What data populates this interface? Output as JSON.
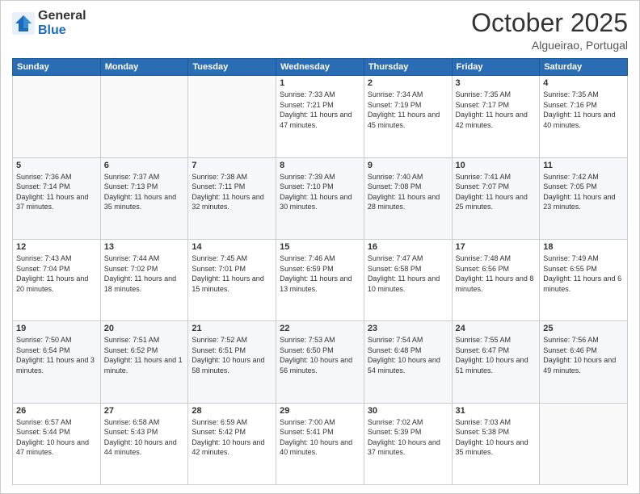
{
  "logo": {
    "general": "General",
    "blue": "Blue"
  },
  "header": {
    "month": "October 2025",
    "location": "Algueirao, Portugal"
  },
  "weekdays": [
    "Sunday",
    "Monday",
    "Tuesday",
    "Wednesday",
    "Thursday",
    "Friday",
    "Saturday"
  ],
  "weeks": [
    [
      {
        "day": "",
        "sunrise": "",
        "sunset": "",
        "daylight": ""
      },
      {
        "day": "",
        "sunrise": "",
        "sunset": "",
        "daylight": ""
      },
      {
        "day": "",
        "sunrise": "",
        "sunset": "",
        "daylight": ""
      },
      {
        "day": "1",
        "sunrise": "Sunrise: 7:33 AM",
        "sunset": "Sunset: 7:21 PM",
        "daylight": "Daylight: 11 hours and 47 minutes."
      },
      {
        "day": "2",
        "sunrise": "Sunrise: 7:34 AM",
        "sunset": "Sunset: 7:19 PM",
        "daylight": "Daylight: 11 hours and 45 minutes."
      },
      {
        "day": "3",
        "sunrise": "Sunrise: 7:35 AM",
        "sunset": "Sunset: 7:17 PM",
        "daylight": "Daylight: 11 hours and 42 minutes."
      },
      {
        "day": "4",
        "sunrise": "Sunrise: 7:35 AM",
        "sunset": "Sunset: 7:16 PM",
        "daylight": "Daylight: 11 hours and 40 minutes."
      }
    ],
    [
      {
        "day": "5",
        "sunrise": "Sunrise: 7:36 AM",
        "sunset": "Sunset: 7:14 PM",
        "daylight": "Daylight: 11 hours and 37 minutes."
      },
      {
        "day": "6",
        "sunrise": "Sunrise: 7:37 AM",
        "sunset": "Sunset: 7:13 PM",
        "daylight": "Daylight: 11 hours and 35 minutes."
      },
      {
        "day": "7",
        "sunrise": "Sunrise: 7:38 AM",
        "sunset": "Sunset: 7:11 PM",
        "daylight": "Daylight: 11 hours and 32 minutes."
      },
      {
        "day": "8",
        "sunrise": "Sunrise: 7:39 AM",
        "sunset": "Sunset: 7:10 PM",
        "daylight": "Daylight: 11 hours and 30 minutes."
      },
      {
        "day": "9",
        "sunrise": "Sunrise: 7:40 AM",
        "sunset": "Sunset: 7:08 PM",
        "daylight": "Daylight: 11 hours and 28 minutes."
      },
      {
        "day": "10",
        "sunrise": "Sunrise: 7:41 AM",
        "sunset": "Sunset: 7:07 PM",
        "daylight": "Daylight: 11 hours and 25 minutes."
      },
      {
        "day": "11",
        "sunrise": "Sunrise: 7:42 AM",
        "sunset": "Sunset: 7:05 PM",
        "daylight": "Daylight: 11 hours and 23 minutes."
      }
    ],
    [
      {
        "day": "12",
        "sunrise": "Sunrise: 7:43 AM",
        "sunset": "Sunset: 7:04 PM",
        "daylight": "Daylight: 11 hours and 20 minutes."
      },
      {
        "day": "13",
        "sunrise": "Sunrise: 7:44 AM",
        "sunset": "Sunset: 7:02 PM",
        "daylight": "Daylight: 11 hours and 18 minutes."
      },
      {
        "day": "14",
        "sunrise": "Sunrise: 7:45 AM",
        "sunset": "Sunset: 7:01 PM",
        "daylight": "Daylight: 11 hours and 15 minutes."
      },
      {
        "day": "15",
        "sunrise": "Sunrise: 7:46 AM",
        "sunset": "Sunset: 6:59 PM",
        "daylight": "Daylight: 11 hours and 13 minutes."
      },
      {
        "day": "16",
        "sunrise": "Sunrise: 7:47 AM",
        "sunset": "Sunset: 6:58 PM",
        "daylight": "Daylight: 11 hours and 10 minutes."
      },
      {
        "day": "17",
        "sunrise": "Sunrise: 7:48 AM",
        "sunset": "Sunset: 6:56 PM",
        "daylight": "Daylight: 11 hours and 8 minutes."
      },
      {
        "day": "18",
        "sunrise": "Sunrise: 7:49 AM",
        "sunset": "Sunset: 6:55 PM",
        "daylight": "Daylight: 11 hours and 6 minutes."
      }
    ],
    [
      {
        "day": "19",
        "sunrise": "Sunrise: 7:50 AM",
        "sunset": "Sunset: 6:54 PM",
        "daylight": "Daylight: 11 hours and 3 minutes."
      },
      {
        "day": "20",
        "sunrise": "Sunrise: 7:51 AM",
        "sunset": "Sunset: 6:52 PM",
        "daylight": "Daylight: 11 hours and 1 minute."
      },
      {
        "day": "21",
        "sunrise": "Sunrise: 7:52 AM",
        "sunset": "Sunset: 6:51 PM",
        "daylight": "Daylight: 10 hours and 58 minutes."
      },
      {
        "day": "22",
        "sunrise": "Sunrise: 7:53 AM",
        "sunset": "Sunset: 6:50 PM",
        "daylight": "Daylight: 10 hours and 56 minutes."
      },
      {
        "day": "23",
        "sunrise": "Sunrise: 7:54 AM",
        "sunset": "Sunset: 6:48 PM",
        "daylight": "Daylight: 10 hours and 54 minutes."
      },
      {
        "day": "24",
        "sunrise": "Sunrise: 7:55 AM",
        "sunset": "Sunset: 6:47 PM",
        "daylight": "Daylight: 10 hours and 51 minutes."
      },
      {
        "day": "25",
        "sunrise": "Sunrise: 7:56 AM",
        "sunset": "Sunset: 6:46 PM",
        "daylight": "Daylight: 10 hours and 49 minutes."
      }
    ],
    [
      {
        "day": "26",
        "sunrise": "Sunrise: 6:57 AM",
        "sunset": "Sunset: 5:44 PM",
        "daylight": "Daylight: 10 hours and 47 minutes."
      },
      {
        "day": "27",
        "sunrise": "Sunrise: 6:58 AM",
        "sunset": "Sunset: 5:43 PM",
        "daylight": "Daylight: 10 hours and 44 minutes."
      },
      {
        "day": "28",
        "sunrise": "Sunrise: 6:59 AM",
        "sunset": "Sunset: 5:42 PM",
        "daylight": "Daylight: 10 hours and 42 minutes."
      },
      {
        "day": "29",
        "sunrise": "Sunrise: 7:00 AM",
        "sunset": "Sunset: 5:41 PM",
        "daylight": "Daylight: 10 hours and 40 minutes."
      },
      {
        "day": "30",
        "sunrise": "Sunrise: 7:02 AM",
        "sunset": "Sunset: 5:39 PM",
        "daylight": "Daylight: 10 hours and 37 minutes."
      },
      {
        "day": "31",
        "sunrise": "Sunrise: 7:03 AM",
        "sunset": "Sunset: 5:38 PM",
        "daylight": "Daylight: 10 hours and 35 minutes."
      },
      {
        "day": "",
        "sunrise": "",
        "sunset": "",
        "daylight": ""
      }
    ]
  ]
}
